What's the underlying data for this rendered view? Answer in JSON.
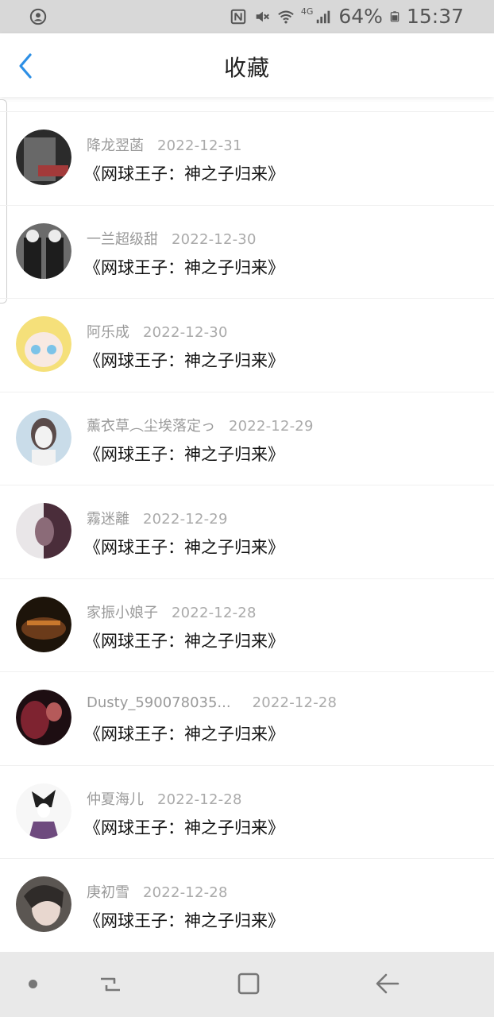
{
  "status_bar": {
    "battery": "64%",
    "time": "15:37",
    "network": "4G"
  },
  "header": {
    "title": "收藏"
  },
  "items": [
    {
      "user": "降龙翌菡",
      "date": "2022-12-31",
      "book": "《网球王子：神之子归来》",
      "avatar_colors": [
        "#2b2b2b",
        "#a33a3a",
        "#d9d9d9"
      ]
    },
    {
      "user": "一兰超级甜",
      "date": "2022-12-30",
      "book": "《网球王子：神之子归来》",
      "avatar_colors": [
        "#1d1d1d",
        "#ececec",
        "#6b6b6b"
      ]
    },
    {
      "user": "阿乐成",
      "date": "2022-12-30",
      "book": "《网球王子：神之子归来》",
      "avatar_colors": [
        "#f5e07a",
        "#f8e9e2",
        "#7cc3e8"
      ]
    },
    {
      "user": "薰衣草︵尘埃落定っ",
      "date": "2022-12-29",
      "book": "《网球王子：神之子归来》",
      "avatar_colors": [
        "#c9dce9",
        "#f2f2f2",
        "#5a4b4a"
      ]
    },
    {
      "user": "霧迷離",
      "date": "2022-12-29",
      "book": "《网球王子：神之子归来》",
      "avatar_colors": [
        "#4a2d3a",
        "#e9e6e8",
        "#8b6b78"
      ]
    },
    {
      "user": "家振小娘子",
      "date": "2022-12-28",
      "book": "《网球王子：神之子归来》",
      "avatar_colors": [
        "#1d140a",
        "#c9782d",
        "#6b3b1a"
      ]
    },
    {
      "user": "Dusty_590078035...",
      "date": "2022-12-28",
      "book": "《网球王子：神之子归来》",
      "avatar_colors": [
        "#1d0e12",
        "#7e2330",
        "#b55a5a"
      ]
    },
    {
      "user": "仲夏海儿",
      "date": "2022-12-28",
      "book": "《网球王子：神之子归来》",
      "avatar_colors": [
        "#f7f7f7",
        "#1f1f1f",
        "#6e4a7e"
      ]
    },
    {
      "user": "庚初雪",
      "date": "2022-12-28",
      "book": "《网球王子：神之子归来》",
      "avatar_colors": [
        "#5b5652",
        "#e8d7cf",
        "#2f2b29"
      ]
    }
  ],
  "colors": {
    "accent": "#2d8fe5",
    "status_bar_bg": "#d8d8d8",
    "nav_bar_bg": "#e9e9e9"
  },
  "icons": {
    "back": "chevron-left-icon",
    "status_left": "account-circle-icon",
    "status_right": [
      "nfc-icon",
      "mute-icon",
      "wifi-icon",
      "signal-icon",
      "battery-icon"
    ],
    "sysnav": [
      "dot-icon",
      "recents-icon",
      "home-icon",
      "back-arrow-icon"
    ]
  }
}
